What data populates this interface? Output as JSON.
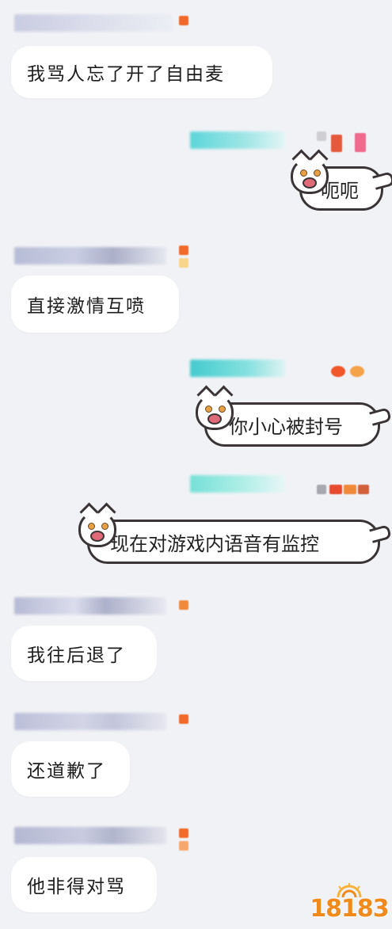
{
  "messages": [
    {
      "side": "left",
      "text": "我骂人忘了开了自由麦"
    },
    {
      "side": "right",
      "text": "呃呃"
    },
    {
      "side": "left",
      "text": "直接激情互喷"
    },
    {
      "side": "right",
      "text": "你小心被封号"
    },
    {
      "side": "right",
      "text": "现在对游戏内语音有监控"
    },
    {
      "side": "left",
      "text": "我往后退了"
    },
    {
      "side": "left",
      "text": "还道歉了"
    },
    {
      "side": "left",
      "text": "他非得对骂"
    }
  ],
  "logo": {
    "text": "18183"
  },
  "colors": {
    "background": "#f1f2f6",
    "bubble": "#ffffff",
    "accent": "#f08a1c"
  }
}
